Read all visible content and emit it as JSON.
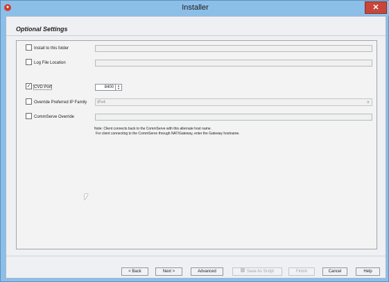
{
  "window": {
    "title": "Installer",
    "close_glyph": "✕"
  },
  "page": {
    "heading": "Optional Settings"
  },
  "rows": {
    "install_folder": {
      "label": "Install to this folder",
      "checked": false,
      "value": ""
    },
    "log_location": {
      "label": "Log File Location",
      "checked": false,
      "value": ""
    },
    "cvd_port": {
      "label": "CVD Port",
      "checked": true,
      "value": "8400"
    },
    "ip_family": {
      "label": "Override Preferred IP Family",
      "checked": false,
      "value": "IPv4"
    },
    "commserve_override": {
      "label": "CommServe Override",
      "checked": false,
      "value": ""
    }
  },
  "note": {
    "line1": "Note: Client connects back to the CommServe with this alternate host name.",
    "line2": "For client connecting to the CommServe through NAT/Gateway, enter the Gateway hostname."
  },
  "buttons": {
    "back": "< Back",
    "next": "Next >",
    "advanced": "Advanced",
    "save_as_script": "Save As Script",
    "finish": "Finish",
    "cancel": "Cancel",
    "help": "Help"
  },
  "icons": {
    "app": "app-logo-icon",
    "close": "close-icon",
    "checkbox_checked": "checkmark-icon",
    "spinner": "spinner-arrows-icon",
    "dropdown": "chevron-down-icon",
    "script": "script-icon",
    "cursor": "mouse-pointer-icon"
  },
  "colors": {
    "titlebar": "#8cbfe8",
    "close_button": "#c7463b",
    "panel_background": "#f3f3f3"
  }
}
